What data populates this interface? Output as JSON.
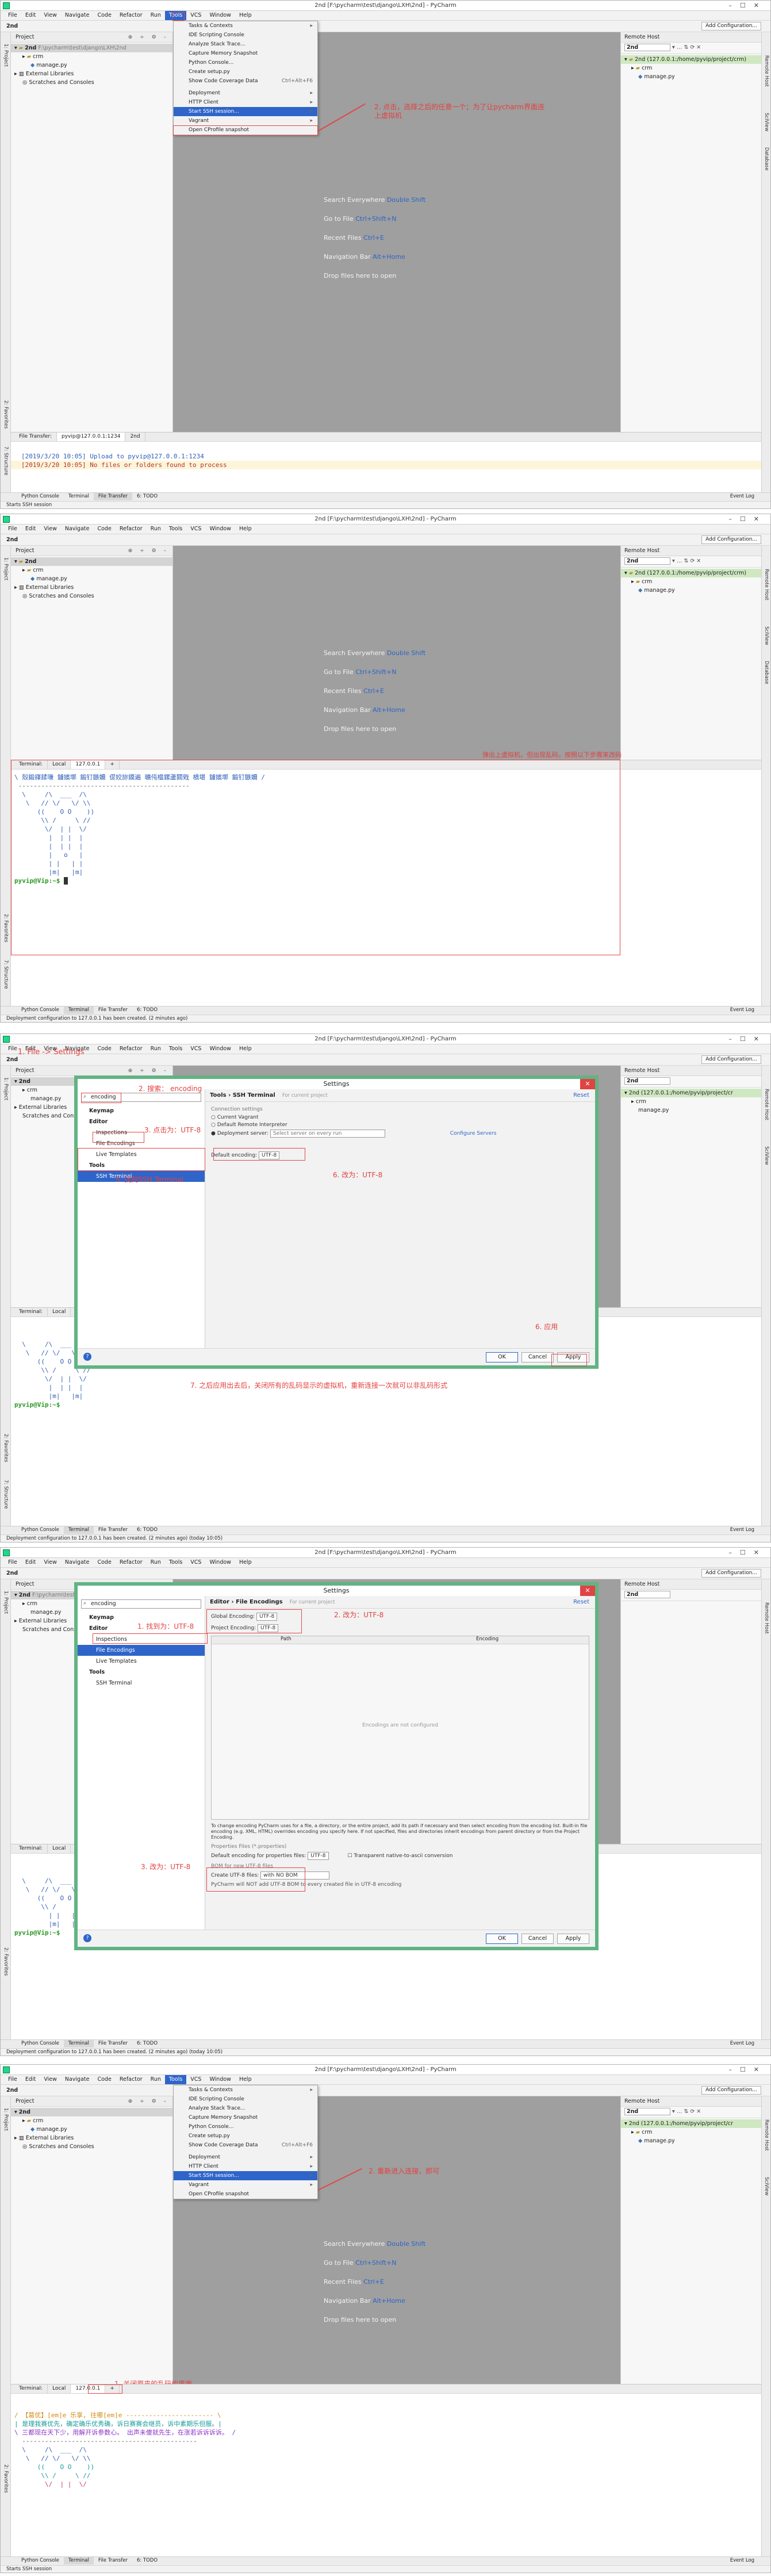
{
  "window_title": "2nd [F:\\pycharm\\test\\django\\LXH\\2nd] - PyCharm",
  "menu": [
    "File",
    "Edit",
    "View",
    "Navigate",
    "Code",
    "Refactor",
    "Run",
    "Tools",
    "VCS",
    "Window",
    "Help"
  ],
  "nav_crumb": "2nd",
  "add_config": "Add Configuration...",
  "project_pane": {
    "title": "Project",
    "root": "2nd",
    "root_path_1": "F:\\pycharm\\test\\django\\LXH\\2nd",
    "root_path_3": "F:\\pycharm\\test\\django\\LXH\\2nd",
    "items": [
      "crm",
      "manage.py",
      "External Libraries",
      "Scratches and Consoles"
    ]
  },
  "remote_host": {
    "title": "Remote Host",
    "server": "2nd",
    "root_1": "2nd (127.0.0.1:/home/pyvip/project/crm)",
    "root_2": "2nd (127.0.0.1:/home/pyvip/project/crm)",
    "root_3": "2nd (127.0.0.1:/home/pyvip/project/cr",
    "root_5": "2nd (127.0.0.1:/home/pyvip/project/cr",
    "items": [
      "crm",
      "manage.py"
    ]
  },
  "tools_menu": {
    "items": [
      {
        "label": "Tasks & Contexts",
        "shortcut": ""
      },
      {
        "label": "IDE Scripting Console",
        "shortcut": ""
      },
      {
        "label": "Analyze Stack Trace...",
        "shortcut": ""
      },
      {
        "label": "Capture Memory Snapshot",
        "shortcut": ""
      },
      {
        "label": "Python Console...",
        "shortcut": ""
      },
      {
        "label": "Create setup.py",
        "shortcut": ""
      },
      {
        "label": "Show Code Coverage Data",
        "shortcut": "Ctrl+Alt+F6"
      },
      {
        "label": "Deployment",
        "shortcut": ""
      },
      {
        "label": "HTTP Client",
        "shortcut": ""
      },
      {
        "label": "Start SSH session...",
        "shortcut": ""
      },
      {
        "label": "Vagrant",
        "shortcut": ""
      },
      {
        "label": "Open CProfile snapshot",
        "shortcut": ""
      }
    ],
    "highlight_index": 9
  },
  "editor_hints": [
    {
      "text": "Search Everywhere ",
      "key": "Double Shift"
    },
    {
      "text": "Go to File ",
      "key": "Ctrl+Shift+N"
    },
    {
      "text": "Recent Files ",
      "key": "Ctrl+E"
    },
    {
      "text": "Navigation Bar ",
      "key": "Alt+Home"
    },
    {
      "text": "Drop files here to open",
      "key": ""
    }
  ],
  "panel1": {
    "note": "2. 点击，选择之后的任意一个；为了让pycharm界面连上虚拟机",
    "bottom_title": "File Transfer:",
    "bottom_tabs": [
      "pyvip@127.0.0.1:1234",
      "2nd"
    ],
    "log": [
      "[2019/3/20 10:05] Upload to pyvip@127.0.0.1:1234",
      "[2019/3/20 10:05] No files or folders found to process"
    ],
    "status": "Starts SSH session"
  },
  "panel2": {
    "note": "弹出上虚拟机，但出现乱码，按照以下步骤来改码",
    "terminal_tabs": [
      "Terminal:",
      "Local",
      "127.0.0.1",
      "+"
    ],
    "garbled": "\\ 殼鍛鎽鍒嗛 鐪嬪墎 鍛钉鏃嬭 偍姣旀鏌遍 曠伅櫙鏍蘆閮戣 樻堪 鐪嬪墎 鍛钉鏃嬭 /",
    "dash": " ---------------------------------------------",
    "art": [
      "  \\     /\\  ___  /\\",
      "   \\   // \\/   \\/ \\\\",
      "      ((    O O    ))",
      "       \\\\ /     \\ //",
      "        \\/  | |  \\/",
      "         |  | |  |",
      "         |  | |  |",
      "         |   o   |",
      "         | |   | |",
      "         |m|   |m|"
    ],
    "prompt": "pyvip@Vip:~$",
    "status": "Deployment configuration to 127.0.0.1 has been created. (2 minutes ago)"
  },
  "panel3": {
    "note_top": "1. File -> Settings",
    "note_search": "2. 搜索： encoding",
    "note_fe": "3. 点击为：UTF-8",
    "note_ssh": "5. 找到SSH Terminal",
    "note_default": "6. 改为：UTF-8",
    "note_apply": "6. 应用",
    "note_bottom": "7. 之后应用出去后，关闭所有的乱码显示的虚拟机，重新连接一次就可以非乱码形式",
    "status": "Deployment configuration to 127.0.0.1 has been created. (2 minutes ago) (today 10:05)"
  },
  "settings_dialog": {
    "title": "Settings",
    "search": "encoding",
    "tree": [
      "Keymap",
      "Editor",
      "Inspections",
      "File Encodings",
      "Live Templates",
      "Tools",
      "SSH Terminal"
    ],
    "crumb_ssh": "Tools  ›  SSH Terminal",
    "crumb_fe": "Editor  ›  File Encodings",
    "for_current": "For current project",
    "reset": "Reset",
    "connection_settings": "Connection settings",
    "opt_current_vagrant": "Current Vagrant",
    "opt_default_remote": "Default Remote Interpreter",
    "opt_deployment": "Deployment server:",
    "select_server": "Select server on every run",
    "configure_servers": "Configure Servers",
    "default_encoding_label": "Default encoding:",
    "default_encoding_value": "UTF-8",
    "global_encoding_label": "Global Encoding:",
    "project_encoding_label": "Project Encoding:",
    "encoding_value": "UTF-8",
    "col_path": "Path",
    "col_encoding": "Encoding",
    "empty": "Encodings are not configured",
    "explain": "To change encoding PyCharm uses for a file, a directory, or the entire project, add its path if necessary and then select encoding from the encoding list. Built-in file encoding (e.g. XML, HTML) overrides encoding you specify here. If not specified, files and directories inherit encodings from parent directory or from the Project Encoding.",
    "props_title": "Properties Files (*.properties)",
    "props_label": "Default encoding for properties files:",
    "transparent": "Transparent native-to-ascii conversion",
    "bom_title": "BOM for new UTF-8 files",
    "bom_label": "Create UTF-8 files:",
    "bom_value": "with NO BOM",
    "bom_note": "PyCharm will NOT add UTF-8 BOM to every created file in UTF-8 encoding",
    "ok": "OK",
    "cancel": "Cancel",
    "apply": "Apply"
  },
  "panel4": {
    "note_global": "2. 改为：UTF-8",
    "note_fe": "1. 找到为：UTF-8",
    "note_props": "3. 改为：UTF-8",
    "status": "Deployment configuration to 127.0.0.1 has been created. (2 minutes ago) (today 10:05)"
  },
  "panel5": {
    "note_ssh": "2. 重新进入连接，即可",
    "note_close": "1. 关闭原来的乱码的界面",
    "terminal_tabs": [
      "Terminal:",
      "Local",
      "127.0.0.1",
      "+"
    ],
    "line1": "/ 【葛优】[em]e 乐享, 往哪[em]e ----------------------- \\",
    "line2": "| 是理我赛优先，确定确乐优秀确，诉日赛赛会继员，诉中素期乐但服。|",
    "line3": "\\ 三都现在天下少，用解开诉参数心。 出声未傻就先生，在涨若诉诉诉诉。 /",
    "dash": "  ----------------------------------------------",
    "art": [
      "  \\     /\\  ___  /\\",
      "   \\   // \\/   \\/ \\\\",
      "      ((    O O    ))",
      "       \\\\ /     \\ //",
      "        \\/  | |  \\/"
    ],
    "status": "Starts SSH session"
  },
  "toolstrip": [
    "Python Console",
    "Terminal",
    "File Transfer",
    "6: TODO"
  ],
  "event_log": "Event Log",
  "side_tabs_left": [
    "1: Project",
    "2: Favorites",
    "7: Structure"
  ],
  "side_tabs_right": [
    "Remote Host",
    "SciView",
    "Database"
  ]
}
